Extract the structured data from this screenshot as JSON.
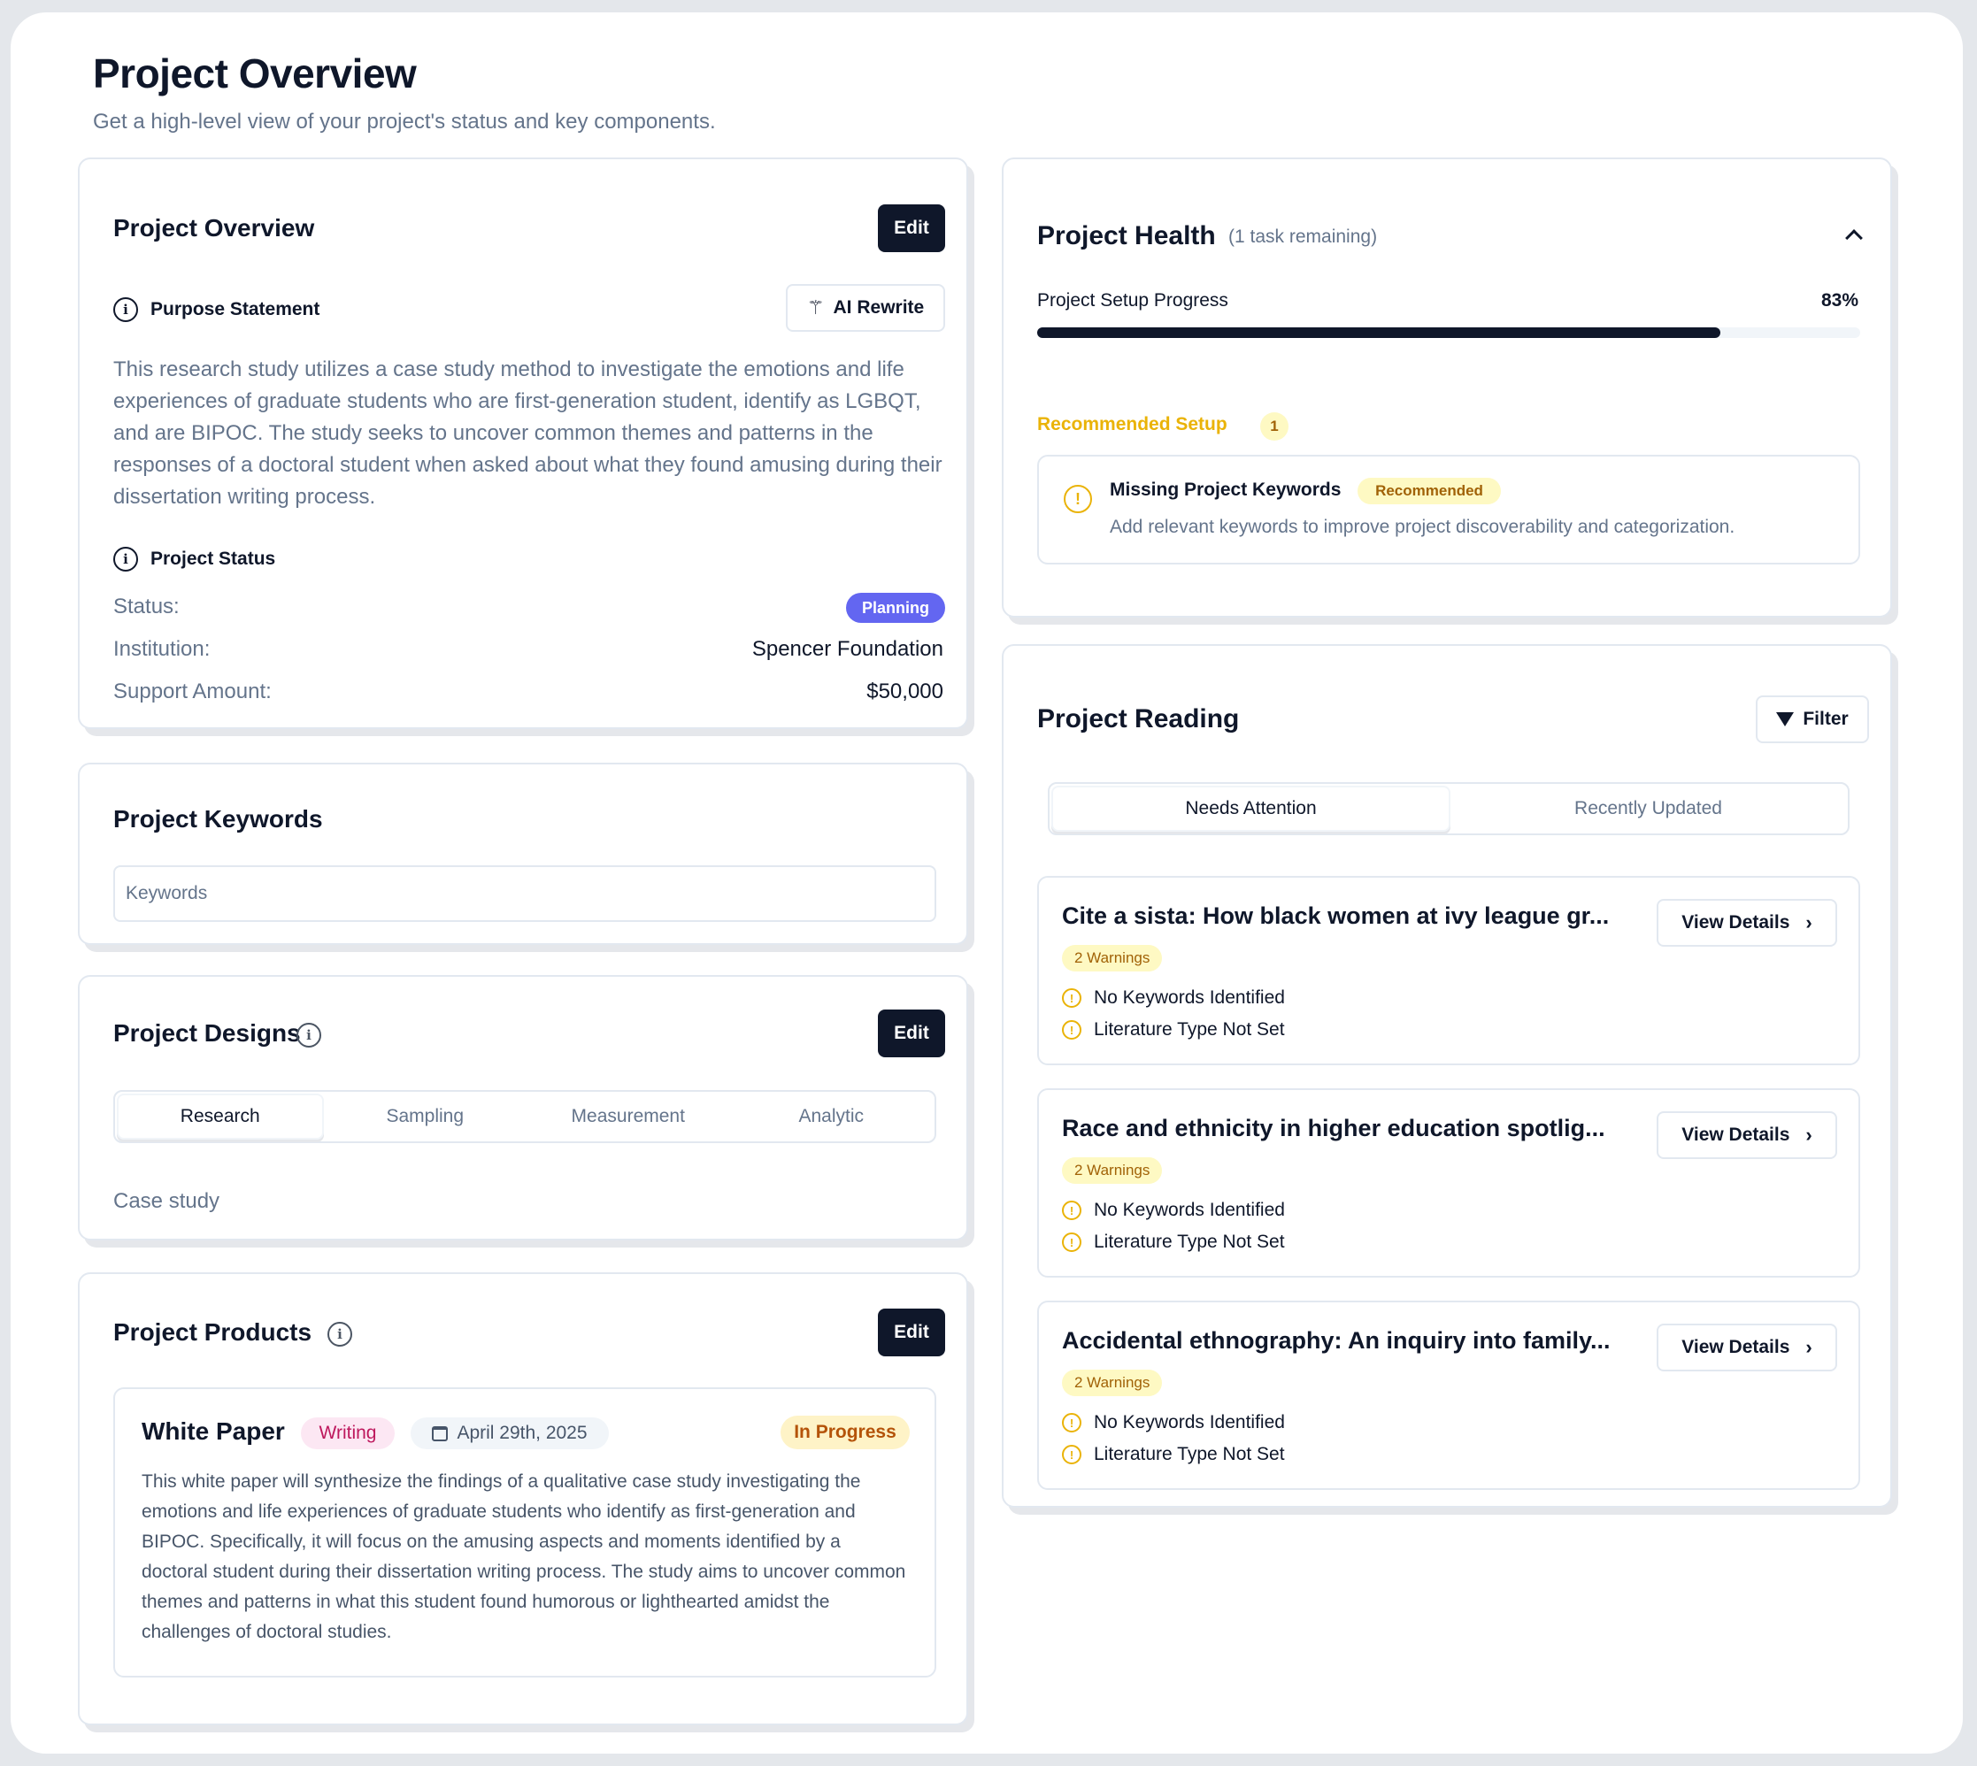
{
  "page": {
    "title": "Project Overview",
    "subtitle": "Get a high-level view of your project's status and key components."
  },
  "overview": {
    "title": "Project Overview",
    "edit_label": "Edit",
    "purpose_label": "Purpose Statement",
    "ai_rewrite_label": "AI Rewrite",
    "purpose_text": "This research study utilizes a case study method to investigate the emotions and life experiences of graduate students who are first-generation student, identify as LGBQT, and are BIPOC. The study seeks to uncover common themes and patterns in the responses of a doctoral student when asked about what they found amusing during their dissertation writing process.",
    "status_section_label": "Project Status",
    "status_label": "Status:",
    "status_value": "Planning",
    "institution_label": "Institution:",
    "institution_value": "Spencer Foundation",
    "support_label": "Support Amount:",
    "support_value": "$50,000"
  },
  "keywords": {
    "title": "Project Keywords",
    "placeholder": "Keywords"
  },
  "designs": {
    "title": "Project Designs",
    "edit_label": "Edit",
    "tabs": [
      "Research",
      "Sampling",
      "Measurement",
      "Analytic"
    ],
    "active_tab": "Research",
    "content": "Case study"
  },
  "products": {
    "title": "Project Products",
    "edit_label": "Edit",
    "item": {
      "title": "White Paper",
      "type": "Writing",
      "date": "April 29th, 2025",
      "status": "In Progress",
      "description": "This white paper will synthesize the findings of a qualitative case study investigating the emotions and life experiences of graduate students who identify as first-generation and BIPOC. Specifically, it will focus on the amusing aspects and moments identified by a doctoral student during their dissertation writing process. The study aims to uncover common themes and patterns in what this student found humorous or lighthearted amidst the challenges of doctoral studies."
    }
  },
  "health": {
    "title": "Project Health",
    "remaining": "(1 task remaining)",
    "progress_label": "Project Setup Progress",
    "progress_value": "83%",
    "progress_fraction": 0.83,
    "recommended_label": "Recommended Setup",
    "recommended_count": "1",
    "alert_title": "Missing Project Keywords",
    "alert_badge": "Recommended",
    "alert_text": "Add relevant keywords to improve project discoverability and categorization."
  },
  "reading": {
    "title": "Project Reading",
    "filter_label": "Filter",
    "tabs": [
      "Needs Attention",
      "Recently Updated"
    ],
    "active_tab": "Needs Attention",
    "items": [
      {
        "title": "Cite a sista: How black women at ivy league gr...",
        "warnings": "2 Warnings",
        "w1": "No Keywords Identified",
        "w2": "Literature Type Not Set",
        "action": "View Details"
      },
      {
        "title": "Race and ethnicity in higher education spotlig...",
        "warnings": "2 Warnings",
        "w1": "No Keywords Identified",
        "w2": "Literature Type Not Set",
        "action": "View Details"
      },
      {
        "title": "Accidental ethnography: An inquiry into family...",
        "warnings": "2 Warnings",
        "w1": "No Keywords Identified",
        "w2": "Literature Type Not Set",
        "action": "View Details"
      }
    ]
  },
  "colors": {
    "primary": "#0f172a",
    "planning": "#6366f1",
    "recommended": "#eab308",
    "writing_bg": "#fce7f3",
    "writing_text": "#be185d",
    "in_progress_bg": "#fef3c7",
    "in_progress_text": "#b45309"
  }
}
